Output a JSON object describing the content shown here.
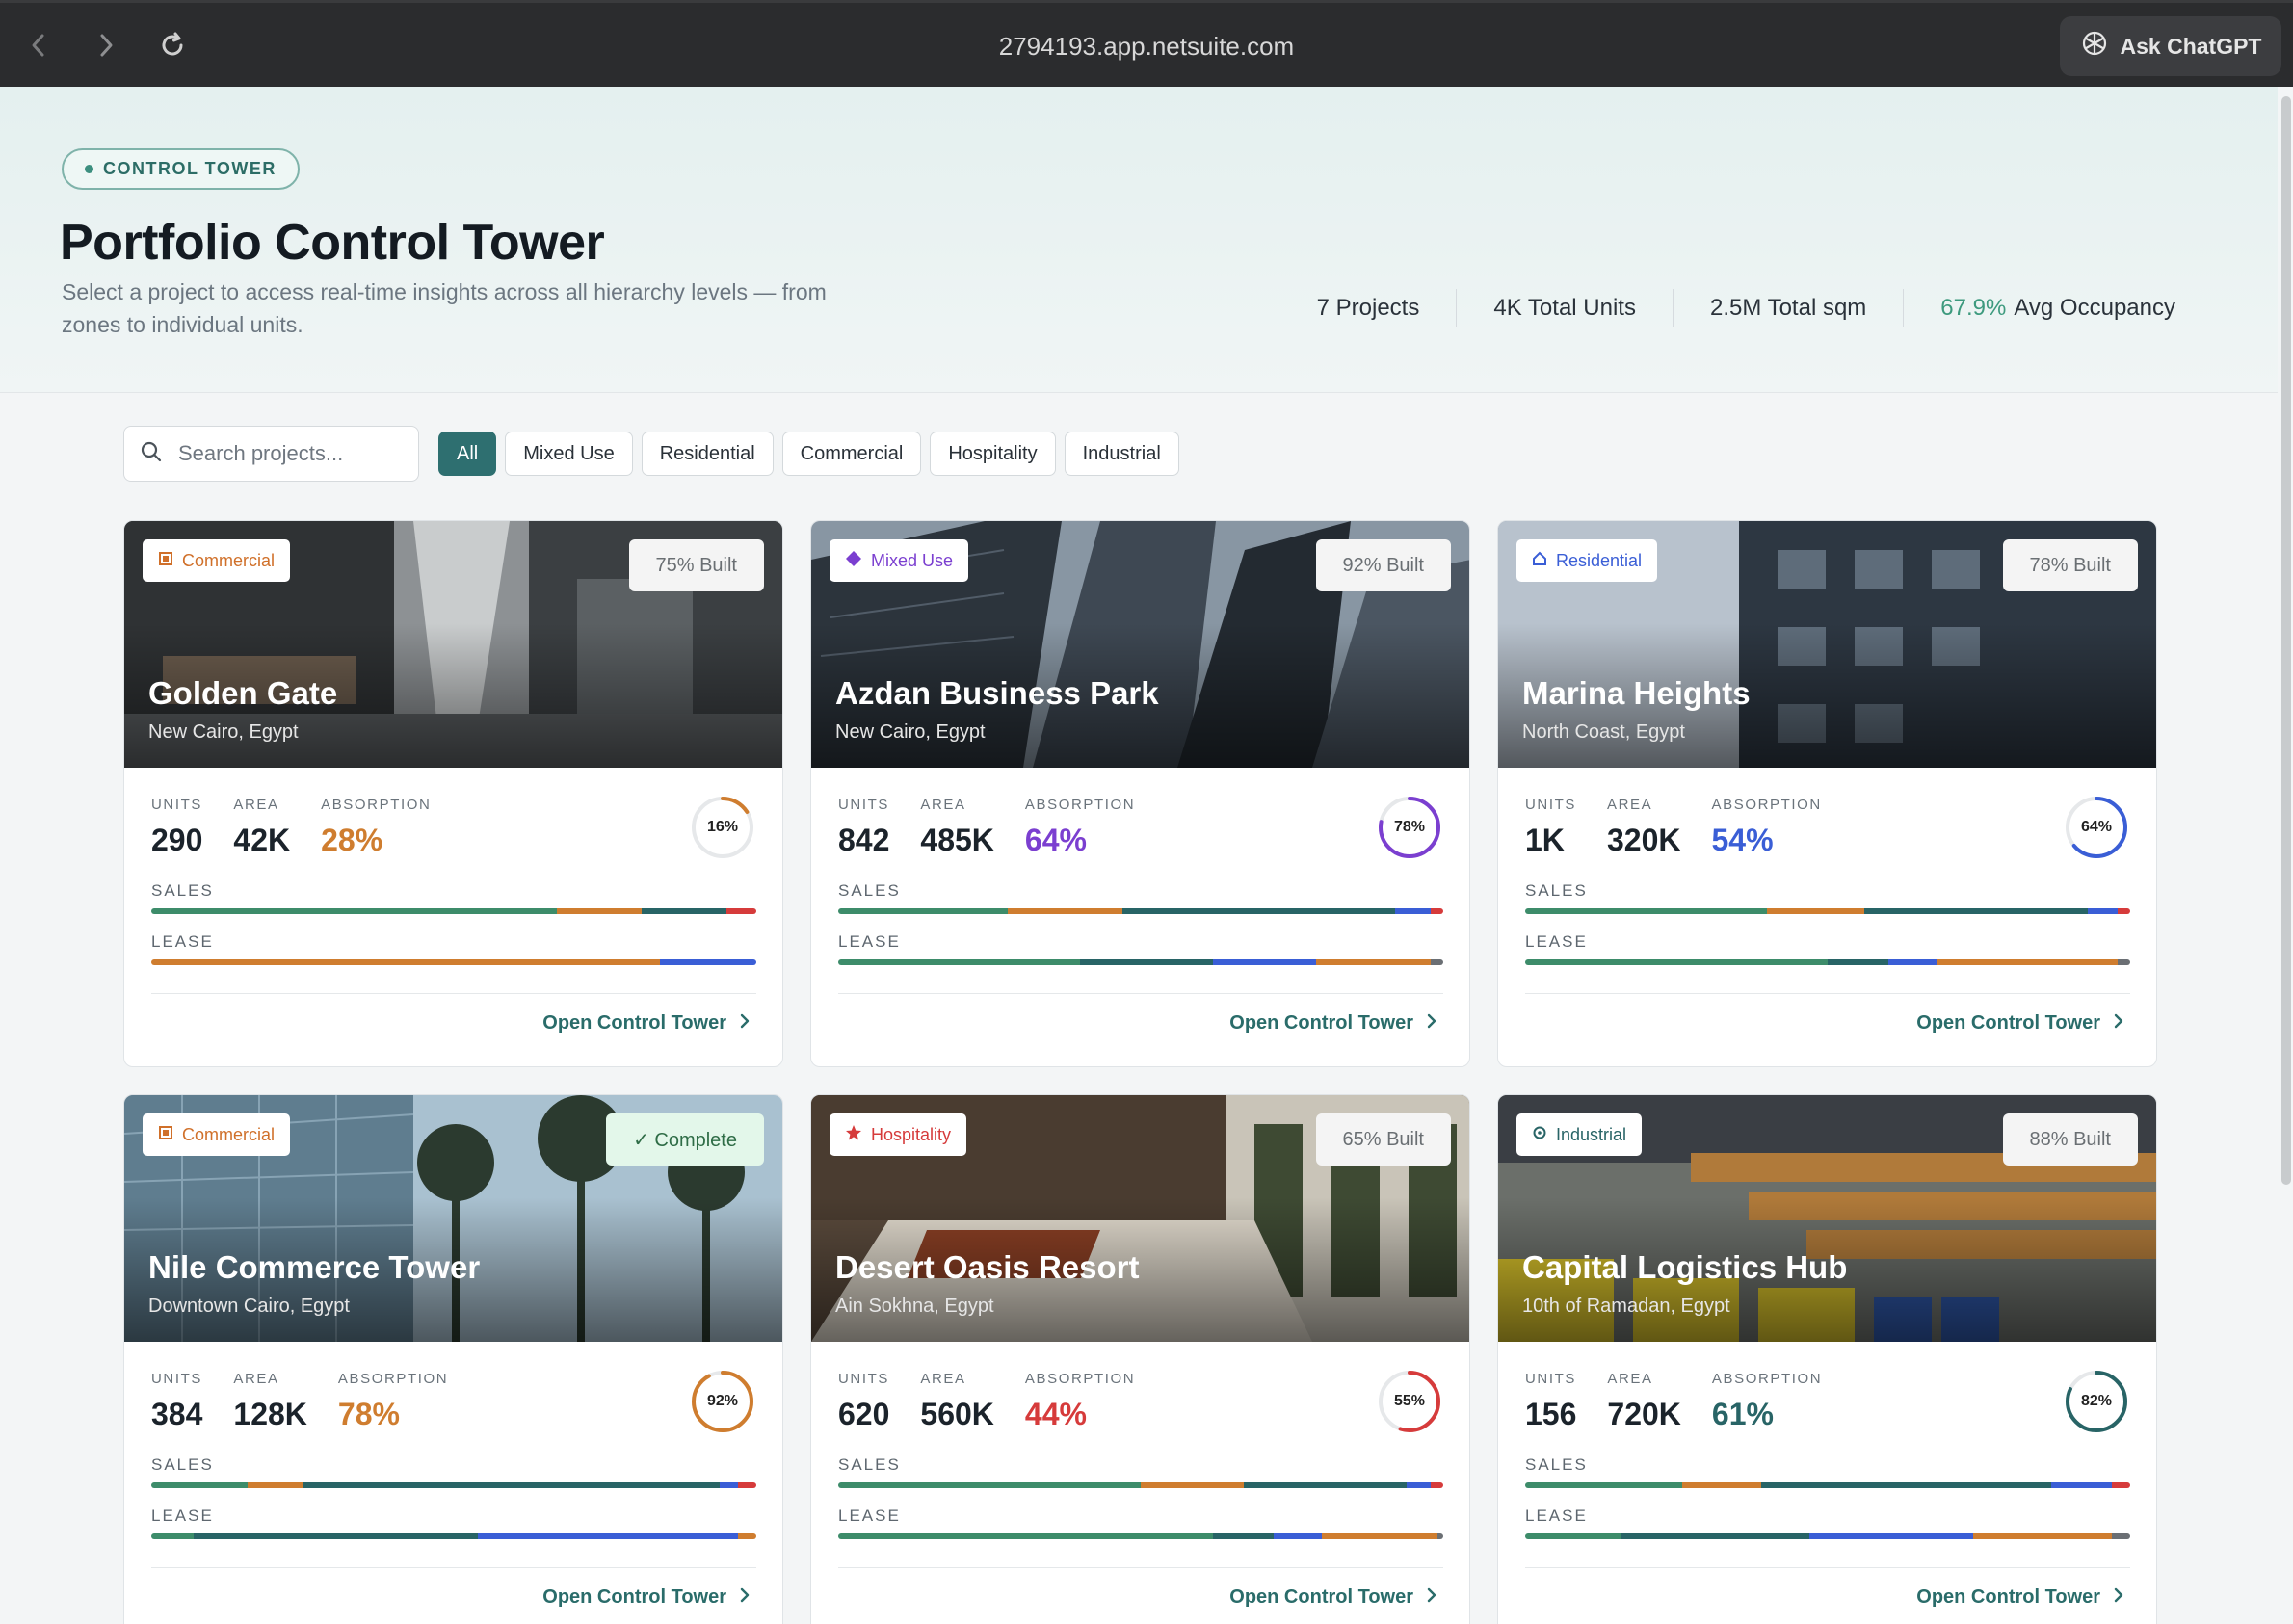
{
  "browser": {
    "url": "2794193.app.netsuite.com",
    "ask_label": "Ask ChatGPT"
  },
  "header": {
    "pill": "CONTROL TOWER",
    "title": "Portfolio Control Tower",
    "subtitle": "Select a project to access real-time insights across all hierarchy levels — from zones to individual units.",
    "stats": {
      "projects": "7 Projects",
      "units": "4K Total Units",
      "sqm": "2.5M Total sqm",
      "occupancy_value": "67.9%",
      "occupancy_label": "Avg Occupancy"
    }
  },
  "filters": {
    "search_placeholder": "Search projects...",
    "chips": [
      "All",
      "Mixed Use",
      "Residential",
      "Commercial",
      "Hospitality",
      "Industrial"
    ],
    "active": "All"
  },
  "labels": {
    "units": "UNITS",
    "area": "AREA",
    "absorption": "ABSORPTION",
    "sales": "SALES",
    "lease": "LEASE",
    "open": "Open Control Tower"
  },
  "colors": {
    "green": "#3d8c6a",
    "orange": "#cf7d2f",
    "teal": "#286466",
    "blue": "#3a5ed6",
    "red": "#d63b3b",
    "gray": "#6b6f74"
  },
  "projects": [
    {
      "type": "Commercial",
      "type_icon": "building-icon",
      "type_color": "#d0702a",
      "built": "75% Built",
      "name": "Golden Gate",
      "location": "New Cairo, Egypt",
      "units": "290",
      "area": "42K",
      "absorption": "28%",
      "absorption_color": "#cf7d2f",
      "ring": 16,
      "ring_label": "16%",
      "ring_color": "#cf7d2f",
      "sales": [
        {
          "c": "green",
          "v": 67
        },
        {
          "c": "orange",
          "v": 14
        },
        {
          "c": "teal",
          "v": 14
        },
        {
          "c": "red",
          "v": 5
        }
      ],
      "lease": [
        {
          "c": "orange",
          "v": 84
        },
        {
          "c": "blue",
          "v": 16
        }
      ]
    },
    {
      "type": "Mixed Use",
      "type_icon": "diamond-icon",
      "type_color": "#7b3fd0",
      "built": "92% Built",
      "name": "Azdan Business Park",
      "location": "New Cairo, Egypt",
      "units": "842",
      "area": "485K",
      "absorption": "64%",
      "absorption_color": "#7b3fd0",
      "ring": 78,
      "ring_label": "78%",
      "ring_color": "#7b3fd0",
      "sales": [
        {
          "c": "green",
          "v": 28
        },
        {
          "c": "orange",
          "v": 19
        },
        {
          "c": "teal",
          "v": 45
        },
        {
          "c": "blue",
          "v": 6
        },
        {
          "c": "red",
          "v": 2
        }
      ],
      "lease": [
        {
          "c": "green",
          "v": 40
        },
        {
          "c": "teal",
          "v": 22
        },
        {
          "c": "blue",
          "v": 17
        },
        {
          "c": "orange",
          "v": 19
        },
        {
          "c": "gray",
          "v": 2
        }
      ]
    },
    {
      "type": "Residential",
      "type_icon": "home-icon",
      "type_color": "#3a5ed6",
      "built": "78% Built",
      "name": "Marina Heights",
      "location": "North Coast, Egypt",
      "units": "1K",
      "area": "320K",
      "absorption": "54%",
      "absorption_color": "#3a5ed6",
      "ring": 64,
      "ring_label": "64%",
      "ring_color": "#3a5ed6",
      "sales": [
        {
          "c": "green",
          "v": 40
        },
        {
          "c": "orange",
          "v": 16
        },
        {
          "c": "teal",
          "v": 37
        },
        {
          "c": "blue",
          "v": 5
        },
        {
          "c": "red",
          "v": 2
        }
      ],
      "lease": [
        {
          "c": "green",
          "v": 50
        },
        {
          "c": "teal",
          "v": 10
        },
        {
          "c": "blue",
          "v": 8
        },
        {
          "c": "orange",
          "v": 30
        },
        {
          "c": "gray",
          "v": 2
        }
      ]
    },
    {
      "type": "Commercial",
      "type_icon": "building-icon",
      "type_color": "#d0702a",
      "built": "✓ Complete",
      "complete": true,
      "name": "Nile Commerce Tower",
      "location": "Downtown Cairo, Egypt",
      "units": "384",
      "area": "128K",
      "absorption": "78%",
      "absorption_color": "#cf7d2f",
      "ring": 92,
      "ring_label": "92%",
      "ring_color": "#cf7d2f",
      "sales": [
        {
          "c": "green",
          "v": 16
        },
        {
          "c": "orange",
          "v": 9
        },
        {
          "c": "teal",
          "v": 69
        },
        {
          "c": "blue",
          "v": 3
        },
        {
          "c": "red",
          "v": 3
        }
      ],
      "lease": [
        {
          "c": "green",
          "v": 7
        },
        {
          "c": "teal",
          "v": 47
        },
        {
          "c": "blue",
          "v": 43
        },
        {
          "c": "orange",
          "v": 3
        }
      ]
    },
    {
      "type": "Hospitality",
      "type_icon": "star-icon",
      "type_color": "#d63b3b",
      "built": "65% Built",
      "name": "Desert Oasis Resort",
      "location": "Ain Sokhna, Egypt",
      "units": "620",
      "area": "560K",
      "absorption": "44%",
      "absorption_color": "#d63b3b",
      "ring": 55,
      "ring_label": "55%",
      "ring_color": "#d63b3b",
      "sales": [
        {
          "c": "green",
          "v": 50
        },
        {
          "c": "orange",
          "v": 17
        },
        {
          "c": "teal",
          "v": 27
        },
        {
          "c": "blue",
          "v": 4
        },
        {
          "c": "red",
          "v": 2
        }
      ],
      "lease": [
        {
          "c": "green",
          "v": 62
        },
        {
          "c": "teal",
          "v": 10
        },
        {
          "c": "blue",
          "v": 8
        },
        {
          "c": "orange",
          "v": 19
        },
        {
          "c": "gray",
          "v": 1
        }
      ]
    },
    {
      "type": "Industrial",
      "type_icon": "gear-icon",
      "type_color": "#286466",
      "built": "88% Built",
      "name": "Capital Logistics Hub",
      "location": "10th of Ramadan, Egypt",
      "units": "156",
      "area": "720K",
      "absorption": "61%",
      "absorption_color": "#286466",
      "ring": 82,
      "ring_label": "82%",
      "ring_color": "#286466",
      "sales": [
        {
          "c": "green",
          "v": 26
        },
        {
          "c": "orange",
          "v": 13
        },
        {
          "c": "teal",
          "v": 48
        },
        {
          "c": "blue",
          "v": 10
        },
        {
          "c": "red",
          "v": 3
        }
      ],
      "lease": [
        {
          "c": "green",
          "v": 16
        },
        {
          "c": "teal",
          "v": 31
        },
        {
          "c": "blue",
          "v": 27
        },
        {
          "c": "orange",
          "v": 23
        },
        {
          "c": "gray",
          "v": 3
        }
      ]
    }
  ]
}
